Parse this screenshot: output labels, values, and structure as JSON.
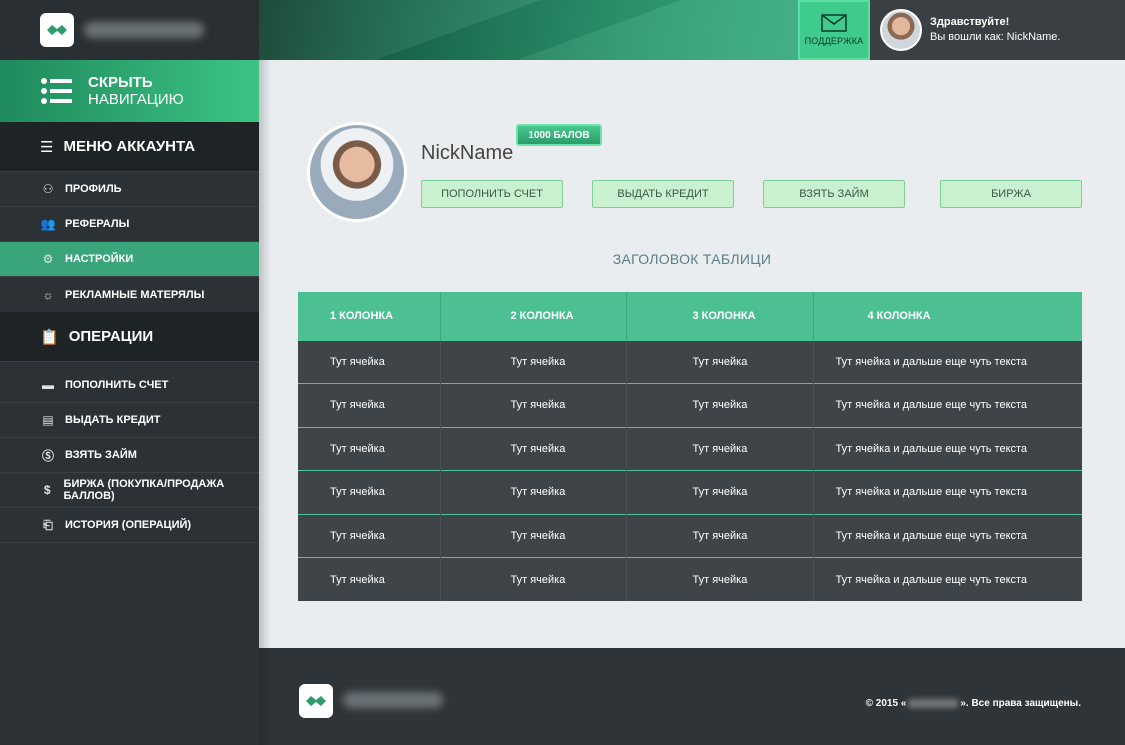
{
  "header": {
    "support_label": "ПОДДЕРЖКА",
    "greeting": "Здравствуйте!",
    "logged_in_as": "Вы вошли как: NickName.",
    "icons": {
      "logo": "handshake-icon",
      "support": "envelope-icon"
    }
  },
  "sidebar": {
    "hide_nav": {
      "line1": "СКРЫТЬ",
      "line2": "НАВИГАЦИЮ",
      "icon": "list-icon"
    },
    "account_menu": {
      "title": "МЕНЮ АККАУНТА",
      "items": [
        {
          "label": "ПРОФИЛЬ",
          "icon": "user-icon",
          "active": false
        },
        {
          "label": "РЕФЕРАЛЫ",
          "icon": "users-icon",
          "active": false
        },
        {
          "label": "НАСТРОЙКИ",
          "icon": "gear-icon",
          "active": true
        },
        {
          "label": "РЕКЛАМНЫЕ МАТЕРЯЛЫ",
          "icon": "lightbulb-icon",
          "active": false
        }
      ]
    },
    "operations": {
      "title": "ОПЕРАЦИИ",
      "items": [
        {
          "label": "ПОПОЛНИТЬ СЧЕТ",
          "icon": "card-icon"
        },
        {
          "label": "ВЫДАТЬ КРЕДИТ",
          "icon": "money-icon"
        },
        {
          "label": "ВЗЯТЬ ЗАЙМ",
          "icon": "dollar-coin-icon"
        },
        {
          "label": "БИРЖА (ПОКУПКА/ПРОДАЖА БАЛЛОВ)",
          "icon": "exchange-icon"
        },
        {
          "label": "ИСТОРИЯ (ОПЕРАЦИЙ)",
          "icon": "history-icon"
        }
      ]
    }
  },
  "profile": {
    "nickname": "NickName",
    "points_badge": "1000 БАЛОВ",
    "actions": [
      "ПОПОЛНИТЬ СЧЕТ",
      "ВЫДАТЬ КРЕДИТ",
      "ВЗЯТЬ ЗАЙМ",
      "БИРЖА"
    ]
  },
  "table": {
    "title": "ЗАГОЛОВОК ТАБЛИЦИ",
    "columns": [
      "1 КОЛОНКА",
      "2 КОЛОНКА",
      "3 КОЛОНКА",
      "4 КОЛОНКА"
    ],
    "rows": [
      [
        "Тут ячейка",
        "Тут ячейка",
        "Тут ячейка",
        "Тут ячейка и дальше еще чуть текста"
      ],
      [
        "Тут ячейка",
        "Тут ячейка",
        "Тут ячейка",
        "Тут ячейка и дальше еще чуть текста"
      ],
      [
        "Тут ячейка",
        "Тут ячейка",
        "Тут ячейка",
        "Тут ячейка и дальше еще чуть текста"
      ],
      [
        "Тут ячейка",
        "Тут ячейка",
        "Тут ячейка",
        "Тут ячейка и дальше еще чуть текста"
      ],
      [
        "Тут ячейка",
        "Тут ячейка",
        "Тут ячейка",
        "Тут ячейка и дальше еще чуть текста"
      ],
      [
        "Тут ячейка",
        "Тут ячейка",
        "Тут ячейка",
        "Тут ячейка и дальше еще чуть текста"
      ]
    ]
  },
  "footer": {
    "copyright_prefix": "© 2015 «",
    "copyright_suffix": "». Все права защищены."
  },
  "colors": {
    "accent": "#3aa57a",
    "header_green": "#4cbf93",
    "sidebar_bg": "#2b3034",
    "row_bg": "#3e4448",
    "button_bg": "#c9f0cf"
  }
}
